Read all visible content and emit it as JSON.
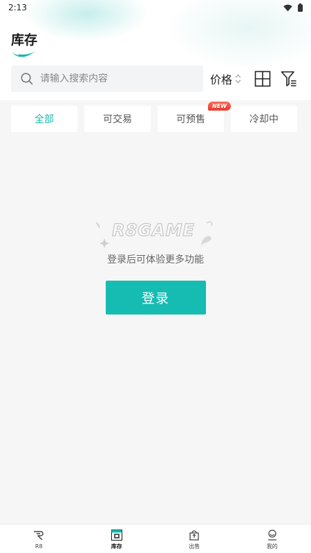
{
  "status_bar": {
    "time": "2:13"
  },
  "header": {
    "title": "库存"
  },
  "search": {
    "placeholder": "请输入搜索内容",
    "value": ""
  },
  "sort": {
    "label": "价格"
  },
  "tabs": [
    {
      "label": "全部",
      "active": true
    },
    {
      "label": "可交易",
      "active": false
    },
    {
      "label": "可预售",
      "active": false,
      "badge": "NEW"
    },
    {
      "label": "冷却中",
      "active": false
    }
  ],
  "empty_state": {
    "logo_text": "R8GAME",
    "message": "登录后可体验更多功能",
    "login_label": "登录"
  },
  "bottom_nav": [
    {
      "label": "R8",
      "icon": "r8-logo-icon",
      "active": false
    },
    {
      "label": "库存",
      "icon": "inventory-icon",
      "active": true
    },
    {
      "label": "出售",
      "icon": "sell-bag-icon",
      "active": false
    },
    {
      "label": "我的",
      "icon": "profile-icon",
      "active": false
    }
  ],
  "colors": {
    "accent": "#16bcb1",
    "badge": "#e8392a",
    "background": "#f6f6f6"
  }
}
